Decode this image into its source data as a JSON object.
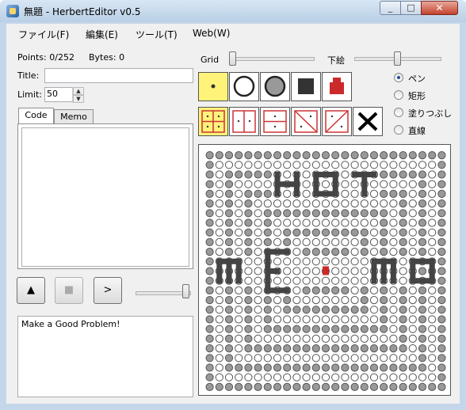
{
  "window": {
    "title": "無題 - HerbertEditor v0.5"
  },
  "menu": [
    {
      "label": "ファイル(F)"
    },
    {
      "label": "編集(E)"
    },
    {
      "label": "ツール(T)"
    },
    {
      "label": "Web(W)"
    }
  ],
  "info": {
    "points": "Points: 0/252",
    "bytes": "Bytes: 0"
  },
  "fields": {
    "title_label": "Title:",
    "title_value": "",
    "limit_label": "Limit:",
    "limit_value": "50"
  },
  "tabs": [
    {
      "label": "Code"
    },
    {
      "label": "Memo"
    }
  ],
  "code": "",
  "controls": {
    "up": "▲",
    "stop": "■",
    "step": ">"
  },
  "status": "Make a Good Problem!",
  "sliders": {
    "grid_label": "Grid",
    "underlay_label": "下絵",
    "speed_level": 1.0,
    "grid_level": 0.0,
    "underlay_level": 0.5
  },
  "modes": [
    {
      "label": "ペン",
      "checked": true
    },
    {
      "label": "矩形",
      "checked": false
    },
    {
      "label": "塗りつぶし",
      "checked": false
    },
    {
      "label": "直線",
      "checked": false
    }
  ],
  "tools_row1": [
    {
      "icon": "dot-icon",
      "selected": true
    },
    {
      "icon": "circle-outline-icon",
      "selected": false
    },
    {
      "icon": "circle-gray-icon",
      "selected": false
    },
    {
      "icon": "square-black-icon",
      "selected": false
    },
    {
      "icon": "robot-red-icon",
      "selected": false
    }
  ],
  "tools_row2": [
    {
      "icon": "flip-both-icon",
      "selected": true
    },
    {
      "icon": "flip-horizontal-icon",
      "selected": false
    },
    {
      "icon": "flip-vertical-icon",
      "selected": false
    },
    {
      "icon": "flip-diagonal-icon",
      "selected": false
    },
    {
      "icon": "flip-antidiagonal-icon",
      "selected": false
    },
    {
      "icon": "clear-icon",
      "selected": false
    }
  ],
  "colors": {
    "selected": "#fff37a",
    "gray_cell": "#888888",
    "wall": "#444444",
    "robot": "#cc2a2a"
  },
  "board_size": 25
}
